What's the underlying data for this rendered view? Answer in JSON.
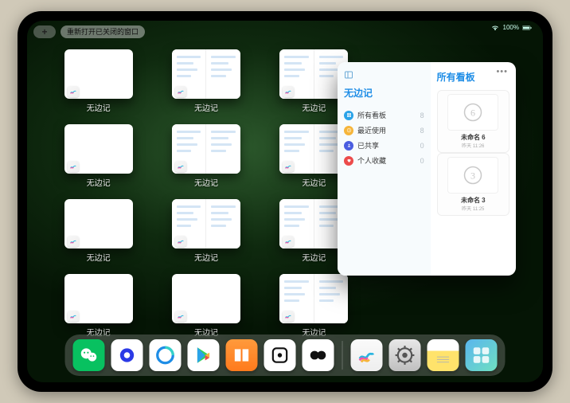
{
  "status": {
    "battery_text": "100%"
  },
  "topbar": {
    "reopen_label": "重新打开已关闭的窗口"
  },
  "app_name": "无边记",
  "stage_items": [
    {
      "label": "无边记",
      "variant": "blank"
    },
    {
      "label": "无边记",
      "variant": "split"
    },
    {
      "label": "无边记",
      "variant": "split"
    },
    {
      "label": "无边记",
      "variant": "blank"
    },
    {
      "label": "无边记",
      "variant": "split"
    },
    {
      "label": "无边记",
      "variant": "split"
    },
    {
      "label": "无边记",
      "variant": "blank"
    },
    {
      "label": "无边记",
      "variant": "split"
    },
    {
      "label": "无边记",
      "variant": "split"
    },
    {
      "label": "无边记",
      "variant": "blank"
    },
    {
      "label": "无边记",
      "variant": "blank"
    },
    {
      "label": "无边记",
      "variant": "split"
    }
  ],
  "freeform_window": {
    "sidebar_title": "无边记",
    "nav": [
      {
        "label": "所有看板",
        "count": "8",
        "color": "blue",
        "icon": "grid"
      },
      {
        "label": "最近使用",
        "count": "8",
        "color": "yellow",
        "icon": "clock"
      },
      {
        "label": "已共享",
        "count": "0",
        "color": "purple",
        "icon": "person"
      },
      {
        "label": "个人收藏",
        "count": "0",
        "color": "red",
        "icon": "heart"
      }
    ],
    "right_title": "所有看板",
    "boards": [
      {
        "name": "未命名 6",
        "date": "昨天 11:26",
        "glyph": "6"
      },
      {
        "name": "未命名 3",
        "date": "昨天 11:25",
        "glyph": "3"
      }
    ]
  },
  "dock": {
    "main": [
      {
        "id": "wechat-icon"
      },
      {
        "id": "quark-icon"
      },
      {
        "id": "qqbrowser-icon"
      },
      {
        "id": "playstore-icon"
      },
      {
        "id": "books-icon"
      },
      {
        "id": "dice-icon"
      },
      {
        "id": "contacts-icon"
      }
    ],
    "recent": [
      {
        "id": "freeform-icon"
      },
      {
        "id": "settings-icon"
      },
      {
        "id": "notes-icon"
      },
      {
        "id": "applibrary-icon"
      }
    ]
  }
}
